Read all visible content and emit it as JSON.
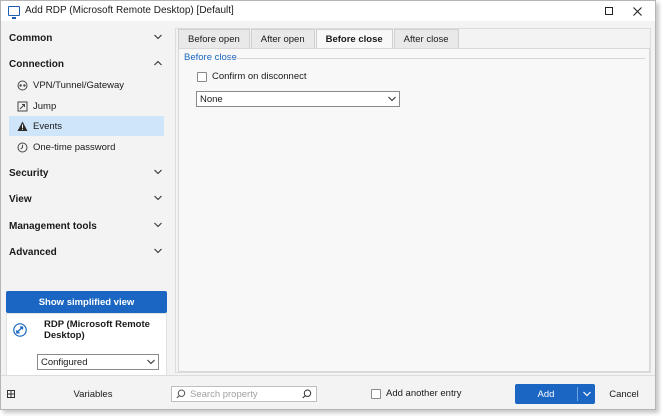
{
  "window": {
    "title": "Add RDP (Microsoft Remote Desktop) [Default]",
    "accent_color": "#1a66c2"
  },
  "sidebar": {
    "sections": [
      {
        "label": "Common",
        "expanded": false
      },
      {
        "label": "Connection",
        "expanded": true
      },
      {
        "label": "Security",
        "expanded": false
      },
      {
        "label": "View",
        "expanded": false
      },
      {
        "label": "Management tools",
        "expanded": false
      },
      {
        "label": "Advanced",
        "expanded": false
      }
    ],
    "connection_items": [
      {
        "label": "VPN/Tunnel/Gateway",
        "icon": "vpn-icon"
      },
      {
        "label": "Jump",
        "icon": "jump-icon"
      },
      {
        "label": "Events",
        "icon": "warning-icon",
        "selected": true
      },
      {
        "label": "One-time password",
        "icon": "clock-icon"
      }
    ],
    "simplified_view_label": "Show simplified view",
    "entry": {
      "name": "RDP (Microsoft Remote Desktop)",
      "status": "Configured",
      "icon": "rdp-icon"
    }
  },
  "main": {
    "tabs": [
      {
        "label": "Before open",
        "active": false
      },
      {
        "label": "After open",
        "active": false
      },
      {
        "label": "Before close",
        "active": true
      },
      {
        "label": "After close",
        "active": false
      }
    ],
    "group_title": "Before close",
    "confirm_checkbox": {
      "label": "Confirm on disconnect",
      "checked": false
    },
    "action_select": {
      "value": "None"
    }
  },
  "footer": {
    "variables_label": "Variables",
    "search_placeholder": "Search property",
    "add_another_label": "Add another entry",
    "add_label": "Add",
    "cancel_label": "Cancel"
  }
}
